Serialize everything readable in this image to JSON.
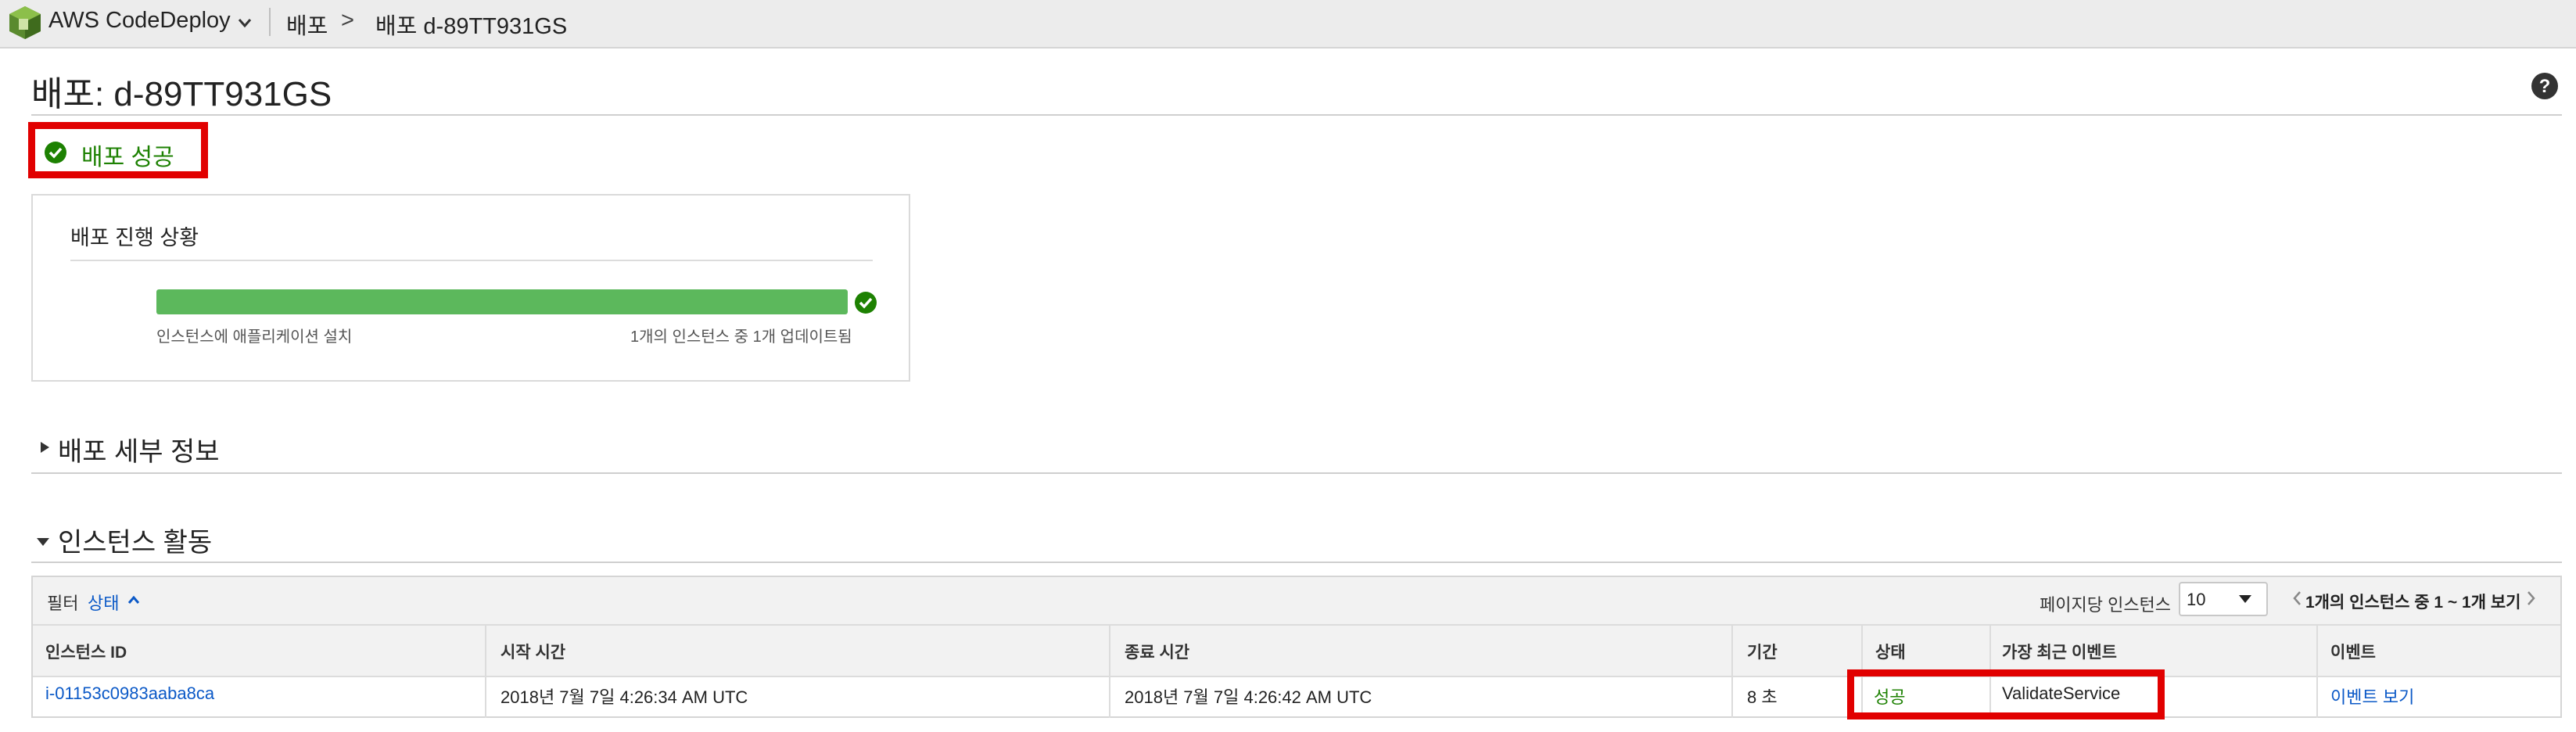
{
  "topbar": {
    "service_name": "AWS CodeDeploy",
    "breadcrumb": [
      "배포",
      "배포 d-89TT931GS"
    ],
    "breadcrumb_separator": ">"
  },
  "page": {
    "title": "배포: d-89TT931GS",
    "status_banner": "배포 성공"
  },
  "progress": {
    "heading": "배포 진행 상황",
    "fraction": 1.0,
    "left_caption": "인스턴스에 애플리케이션 설치",
    "right_caption": "1개의 인스턴스 중 1개 업데이트됨"
  },
  "sections": {
    "details": "배포 세부 정보",
    "activity": "인스턴스 활동"
  },
  "table": {
    "filter_label": "필터",
    "filter_status": "상태",
    "per_page_label": "페이지당 인스턴스",
    "per_page_value": "10",
    "pagination": "1개의 인스턴스 중 1 ~ 1개 보기",
    "columns": [
      "인스턴스 ID",
      "시작 시간",
      "종료 시간",
      "기간",
      "상태",
      "가장 최근 이벤트",
      "이벤트"
    ],
    "rows": [
      {
        "instance_id": "i-01153c0983aaba8ca",
        "start": "2018년 7월 7일 4:26:34 AM UTC",
        "end": "2018년 7월 7일 4:26:42 AM UTC",
        "duration": "8 초",
        "status": "성공",
        "latest_event": "ValidateService",
        "events_link": "이벤트 보기"
      }
    ]
  },
  "colors": {
    "success": "#1d8102",
    "link": "#0b59c7",
    "progress": "#5cb85c",
    "highlight": "#e10000"
  }
}
